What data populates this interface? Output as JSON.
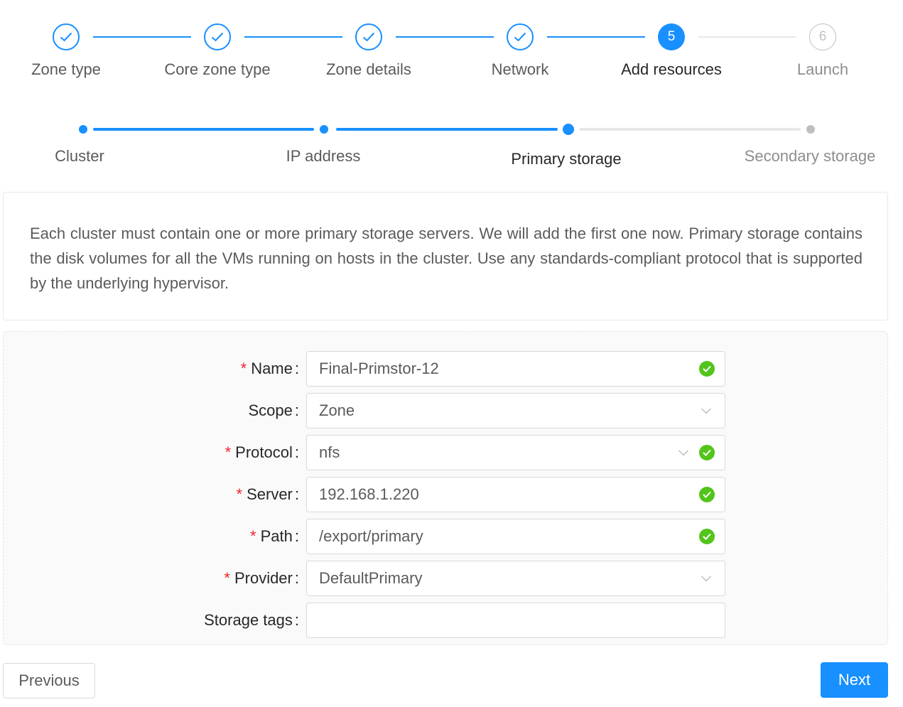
{
  "colors": {
    "primary": "#1890ff",
    "success": "#52c41a",
    "required": "#f5222d",
    "wait": "#bfbfbf"
  },
  "steps": [
    {
      "label": "Zone type",
      "status": "done",
      "icon": "check-icon"
    },
    {
      "label": "Core zone type",
      "status": "done",
      "icon": "check-icon"
    },
    {
      "label": "Zone details",
      "status": "done",
      "icon": "check-icon"
    },
    {
      "label": "Network",
      "status": "done",
      "icon": "check-icon"
    },
    {
      "label": "Add resources",
      "status": "process",
      "number": "5"
    },
    {
      "label": "Launch",
      "status": "wait",
      "number": "6"
    }
  ],
  "substeps": [
    {
      "label": "Cluster",
      "status": "done"
    },
    {
      "label": "IP address",
      "status": "done"
    },
    {
      "label": "Primary storage",
      "status": "process"
    },
    {
      "label": "Secondary storage",
      "status": "wait"
    }
  ],
  "description": "Each cluster must contain one or more primary storage servers. We will add the first one now. Primary storage contains the disk volumes for all the VMs running on hosts in the cluster. Use any standards-compliant protocol that is supported by the underlying hypervisor.",
  "form": {
    "name": {
      "label": "Name",
      "value": "Final-Primstor-12",
      "required": true,
      "valid": true
    },
    "scope": {
      "label": "Scope",
      "value": "Zone",
      "required": false,
      "type": "select"
    },
    "protocol": {
      "label": "Protocol",
      "value": "nfs",
      "required": true,
      "valid": true,
      "type": "select"
    },
    "server": {
      "label": "Server",
      "value": "192.168.1.220",
      "required": true,
      "valid": true
    },
    "path": {
      "label": "Path",
      "value": "/export/primary",
      "required": true,
      "valid": true
    },
    "provider": {
      "label": "Provider",
      "value": "DefaultPrimary",
      "required": true,
      "type": "select"
    },
    "storage_tags": {
      "label": "Storage tags",
      "value": "",
      "required": false
    }
  },
  "req_mark": "*",
  "colon": ":",
  "buttons": {
    "previous": "Previous",
    "next": "Next"
  }
}
